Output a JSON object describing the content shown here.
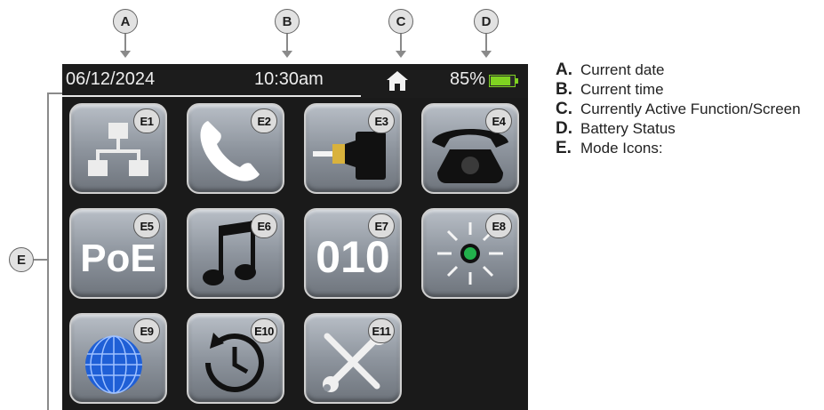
{
  "callouts": {
    "a": "A",
    "b": "B",
    "c": "C",
    "d": "D",
    "e": "E"
  },
  "status_bar": {
    "date": "06/12/2024",
    "time": "10:30am",
    "active_function_icon": "home-icon",
    "battery_text": "85%",
    "battery_level": 0.85,
    "battery_color": "#7fd321"
  },
  "tiles": [
    {
      "badge": "E1",
      "icon": "network-icon"
    },
    {
      "badge": "E2",
      "icon": "phone-handset-icon"
    },
    {
      "badge": "E3",
      "icon": "cable-connector-icon"
    },
    {
      "badge": "E4",
      "icon": "desk-telephone-icon"
    },
    {
      "badge": "E5",
      "icon": "poe-icon",
      "text": "PoE"
    },
    {
      "badge": "E6",
      "icon": "music-notes-icon"
    },
    {
      "badge": "E7",
      "icon": "binary-icon",
      "text": "010"
    },
    {
      "badge": "E8",
      "icon": "blinking-light-icon",
      "light_color": "#22b14c"
    },
    {
      "badge": "E9",
      "icon": "globe-icon",
      "globe_color": "#1f5fd6"
    },
    {
      "badge": "E10",
      "icon": "history-clock-icon"
    },
    {
      "badge": "E11",
      "icon": "tools-icon"
    }
  ],
  "legend": [
    {
      "letter": "A.",
      "text": "Current date"
    },
    {
      "letter": "B.",
      "text": "Current time"
    },
    {
      "letter": "C.",
      "text": "Currently Active Function/Screen"
    },
    {
      "letter": "D.",
      "text": "Battery Status"
    },
    {
      "letter": "E.",
      "text": "Mode Icons:"
    }
  ]
}
